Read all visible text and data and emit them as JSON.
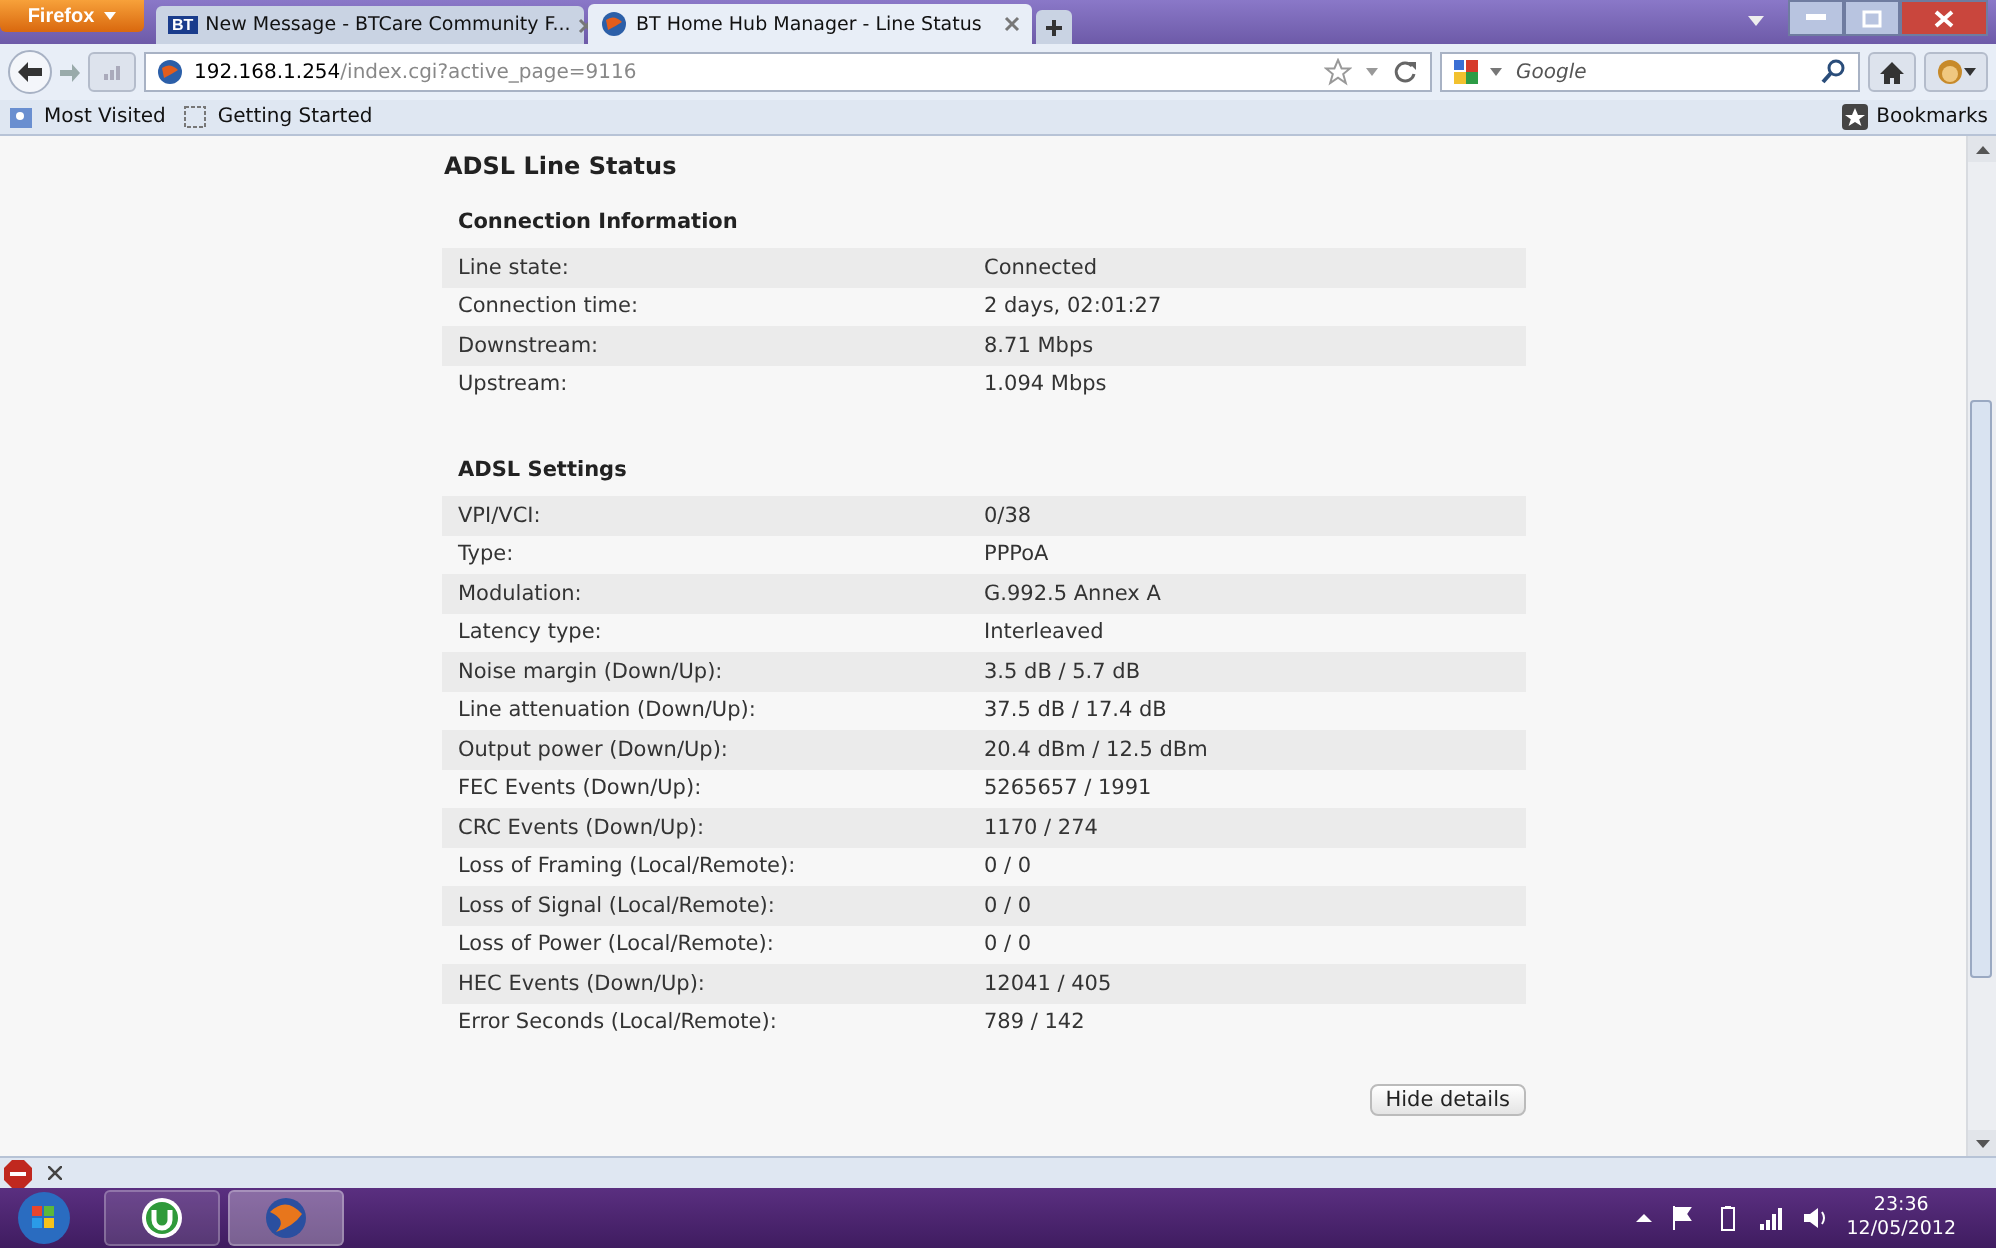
{
  "browser": {
    "menu_button": "Firefox",
    "tabs": [
      {
        "title": "New Message - BTCare Community F...",
        "favicon": "BT",
        "selected": false
      },
      {
        "title": "BT Home Hub Manager - Line Status",
        "selected": true
      }
    ],
    "url": {
      "host": "192.168.1.254",
      "path": "/index.cgi?active_page=9116"
    },
    "search": {
      "placeholder": "Google"
    },
    "bookmarks": [
      "Most Visited",
      "Getting Started"
    ],
    "bookmarks_menu": "Bookmarks"
  },
  "page": {
    "title": "ADSL Line Status",
    "sections": [
      {
        "heading": "Connection Information",
        "rows": [
          {
            "label": "Line state:",
            "value": "Connected"
          },
          {
            "label": "Connection time:",
            "value": "2 days, 02:01:27"
          },
          {
            "label": "Downstream:",
            "value": "8.71 Mbps"
          },
          {
            "label": "Upstream:",
            "value": "1.094 Mbps"
          }
        ]
      },
      {
        "heading": "ADSL Settings",
        "rows": [
          {
            "label": "VPI/VCI:",
            "value": "0/38"
          },
          {
            "label": "Type:",
            "value": "PPPoA"
          },
          {
            "label": "Modulation:",
            "value": "G.992.5 Annex A"
          },
          {
            "label": "Latency type:",
            "value": "Interleaved"
          },
          {
            "label": "Noise margin (Down/Up):",
            "value": "3.5 dB / 5.7 dB"
          },
          {
            "label": "Line attenuation (Down/Up):",
            "value": "37.5 dB / 17.4 dB"
          },
          {
            "label": "Output power (Down/Up):",
            "value": "20.4 dBm / 12.5 dBm"
          },
          {
            "label": "FEC Events (Down/Up):",
            "value": "5265657 / 1991"
          },
          {
            "label": "CRC Events (Down/Up):",
            "value": "1170 / 274"
          },
          {
            "label": "Loss of Framing (Local/Remote):",
            "value": "0 / 0"
          },
          {
            "label": "Loss of Signal (Local/Remote):",
            "value": "0 / 0"
          },
          {
            "label": "Loss of Power (Local/Remote):",
            "value": "0 / 0"
          },
          {
            "label": "HEC Events (Down/Up):",
            "value": "12041 / 405"
          },
          {
            "label": "Error Seconds (Local/Remote):",
            "value": "789 / 142"
          }
        ]
      }
    ],
    "button": "Hide details"
  },
  "taskbar": {
    "time": "23:36",
    "date": "12/05/2012"
  }
}
